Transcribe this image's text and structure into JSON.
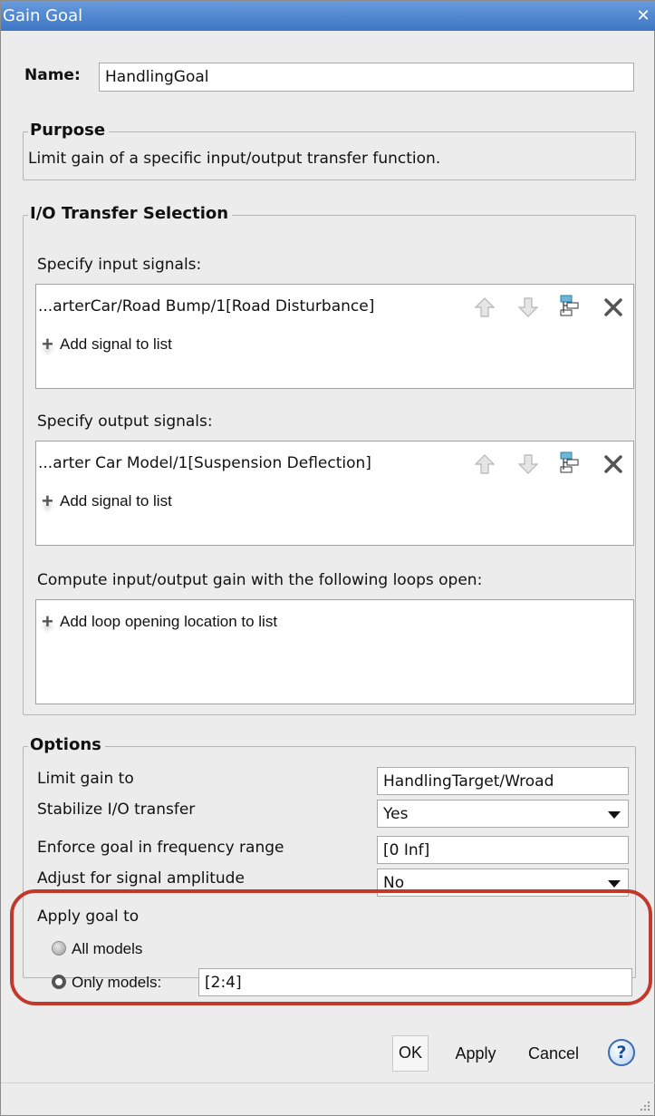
{
  "window": {
    "title": "Gain Goal"
  },
  "name_field": {
    "label": "Name:",
    "value": "HandlingGoal"
  },
  "purpose": {
    "legend": "Purpose",
    "text": "Limit gain of a specific input/output transfer function."
  },
  "io_selection": {
    "legend": "I/O Transfer Selection",
    "input_label": "Specify input signals:",
    "input_signals": [
      "...arterCar/Road Bump/1[Road Disturbance]"
    ],
    "input_add": "Add signal to list",
    "output_label": "Specify output signals:",
    "output_signals": [
      "...arter Car Model/1[Suspension Deflection]"
    ],
    "output_add": "Add signal to list",
    "loops_label": "Compute input/output gain with the following loops open:",
    "loops_add": "Add loop opening location to list"
  },
  "icons": {
    "move_up": "arrow-up-icon",
    "move_down": "arrow-down-icon",
    "highlight": "highlight-model-icon",
    "delete": "delete-x-icon",
    "help": "help-icon"
  },
  "options": {
    "legend": "Options",
    "limit_gain_label": "Limit gain to",
    "limit_gain_value": "HandlingTarget/Wroad",
    "stabilize_label": "Stabilize I/O transfer",
    "stabilize_value": "Yes",
    "freq_label": "Enforce goal in frequency range",
    "freq_value": "[0 Inf]",
    "amplitude_label": "Adjust for signal amplitude",
    "amplitude_value": "No",
    "apply_label": "Apply goal to",
    "all_models": "All models",
    "only_models": "Only models:",
    "only_models_value": "[2:4]",
    "selected": "only_models"
  },
  "buttons": {
    "ok": "OK",
    "apply": "Apply",
    "cancel": "Cancel",
    "help": "?"
  },
  "colors": {
    "titlebar": "#4f86cf",
    "highlight_ring": "#c0392b"
  }
}
